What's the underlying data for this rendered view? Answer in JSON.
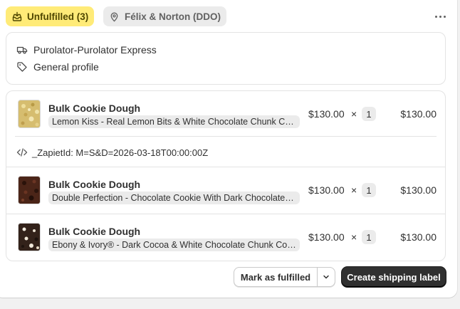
{
  "header": {
    "status_badge": "Unfulfilled (3)",
    "location_badge": "Félix & Norton (DDO)",
    "more_label": "···"
  },
  "shipping": {
    "method": "Purolator-Purolator Express",
    "profile": "General profile"
  },
  "line_items": [
    {
      "title": "Bulk Cookie Dough",
      "variant": "Lemon Kiss - Real Lemon Bits & White Chocolate Chunk Cookie",
      "price": "$130.00",
      "times": "×",
      "quantity": "1",
      "total": "$130.00",
      "property": "_ZapietId: M=S&D=2026-03-18T00:00:00Z",
      "thumb_color": "#d8c27a"
    },
    {
      "title": "Bulk Cookie Dough",
      "variant": "Double Perfection - Chocolate Cookie With Dark Chocolate Chunks",
      "price": "$130.00",
      "times": "×",
      "quantity": "1",
      "total": "$130.00",
      "thumb_color": "#4a2418"
    },
    {
      "title": "Bulk Cookie Dough",
      "variant": "Ebony & Ivory® - Dark Cocoa & White Chocolate Chunk Cookie",
      "price": "$130.00",
      "times": "×",
      "quantity": "1",
      "total": "$130.00",
      "thumb_color": "#3a2a22"
    }
  ],
  "actions": {
    "mark_fulfilled": "Mark as fulfilled",
    "create_label": "Create shipping label"
  },
  "colors": {
    "status_badge_bg": "#ffeb78",
    "primary_button": "#303030"
  }
}
